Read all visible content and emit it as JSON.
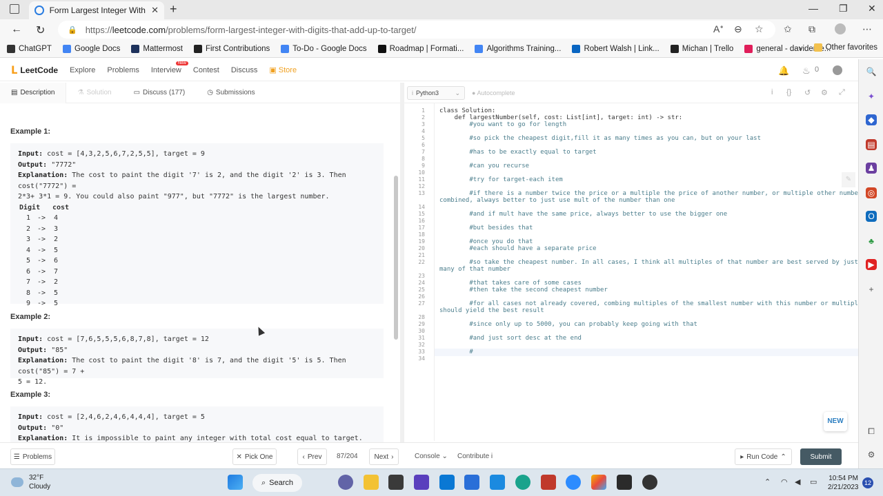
{
  "browser": {
    "tab_title": "Form Largest Integer With Digits",
    "url_prefix": "https://",
    "url_host": "leetcode.com",
    "url_path": "/problems/form-largest-integer-with-digits-that-add-up-to-target/"
  },
  "bookmarks": [
    {
      "label": "ChatGPT",
      "color": "#333333"
    },
    {
      "label": "Google Docs",
      "color": "#4285f4"
    },
    {
      "label": "Mattermost",
      "color": "#1e325c"
    },
    {
      "label": "First Contributions",
      "color": "#222222"
    },
    {
      "label": "To-Do - Google Docs",
      "color": "#4285f4"
    },
    {
      "label": "Roadmap | Formati...",
      "color": "#111111"
    },
    {
      "label": "Algorithms Training...",
      "color": "#4285f4"
    },
    {
      "label": "Robert Walsh | Link...",
      "color": "#0a66c2"
    },
    {
      "label": "Michan | Trello",
      "color": "#222222"
    },
    {
      "label": "general - davideme...",
      "color": "#e01e5a"
    }
  ],
  "bookmarks_other": "Other favorites",
  "lcnav": {
    "logo": "LeetCode",
    "items": [
      "Explore",
      "Problems",
      "Interview",
      "Contest",
      "Discuss"
    ],
    "store": "Store",
    "new_badge": "New",
    "flame_count": "0"
  },
  "lefttabs": {
    "description": "Description",
    "solution": "Solution",
    "discuss": "Discuss (177)",
    "submissions": "Submissions"
  },
  "examples": [
    {
      "heading": "Example 1:",
      "input_label": "Input:",
      "input": "cost = [4,3,2,5,6,7,2,5,5], target = 9",
      "output_label": "Output:",
      "output": "\"7772\"",
      "expl_label": "Explanation:",
      "explanation1": "The cost to paint the digit '7' is 2, and the digit '2' is 3. Then cost(\"7772\") =",
      "explanation2": "2*3+ 3*1 = 9. You could also paint \"977\", but \"7772\" is the largest number.",
      "table_headers": [
        "Digit",
        "cost"
      ],
      "table_rows": [
        [
          "1",
          "->",
          "4"
        ],
        [
          "2",
          "->",
          "3"
        ],
        [
          "3",
          "->",
          "2"
        ],
        [
          "4",
          "->",
          "5"
        ],
        [
          "5",
          "->",
          "6"
        ],
        [
          "6",
          "->",
          "7"
        ],
        [
          "7",
          "->",
          "2"
        ],
        [
          "8",
          "->",
          "5"
        ],
        [
          "9",
          "->",
          "5"
        ]
      ]
    },
    {
      "heading": "Example 2:",
      "input_label": "Input:",
      "input": "cost = [7,6,5,5,5,6,8,7,8], target = 12",
      "output_label": "Output:",
      "output": "\"85\"",
      "expl_label": "Explanation:",
      "explanation1": "The cost to paint the digit '8' is 7, and the digit '5' is 5. Then cost(\"85\") = 7 +",
      "explanation2": "5 = 12."
    },
    {
      "heading": "Example 3:",
      "input_label": "Input:",
      "input": "cost = [2,4,6,2,4,6,4,4,4], target = 5",
      "output_label": "Output:",
      "output": "\"0\"",
      "expl_label": "Explanation:",
      "explanation1": "It is impossible to paint any integer with total cost equal to target."
    }
  ],
  "editor": {
    "language": "Python3",
    "autocomplete": "Autocomplete"
  },
  "code_lines": [
    {
      "n": "1",
      "t": "class Solution:",
      "c": false
    },
    {
      "n": "2",
      "t": "    def largestNumber(self, cost: List[int], target: int) -> str:",
      "c": false
    },
    {
      "n": "3",
      "t": "        #you want to go for length",
      "c": true
    },
    {
      "n": "4",
      "t": "",
      "c": false
    },
    {
      "n": "5",
      "t": "        #so pick the cheapest digit,fill it as many times as you can, but on your last",
      "c": true
    },
    {
      "n": "6",
      "t": "",
      "c": false
    },
    {
      "n": "7",
      "t": "        #has to be exactly equal to target",
      "c": true
    },
    {
      "n": "8",
      "t": "",
      "c": false
    },
    {
      "n": "9",
      "t": "        #can you recurse",
      "c": true
    },
    {
      "n": "10",
      "t": "",
      "c": false
    },
    {
      "n": "11",
      "t": "        #try for target-each item",
      "c": true
    },
    {
      "n": "12",
      "t": "",
      "c": false
    },
    {
      "n": "13",
      "t": "        #if there is a number twice the price or a multiple the price of another number, or multiple other numbers",
      "c": true
    },
    {
      "n": "",
      "t": "combined, always better to just use mult of the number than one",
      "c": true
    },
    {
      "n": "14",
      "t": "",
      "c": false
    },
    {
      "n": "15",
      "t": "        #and if mult have the same price, always better to use the bigger one",
      "c": true
    },
    {
      "n": "16",
      "t": "",
      "c": false
    },
    {
      "n": "17",
      "t": "        #but besides that",
      "c": true
    },
    {
      "n": "18",
      "t": "",
      "c": false
    },
    {
      "n": "19",
      "t": "        #once you do that",
      "c": true
    },
    {
      "n": "20",
      "t": "        #each should have a separate price",
      "c": true
    },
    {
      "n": "21",
      "t": "",
      "c": false
    },
    {
      "n": "22",
      "t": "        #so take the cheapest number. In all cases, I think all multiples of that number are best served by just using",
      "c": true
    },
    {
      "n": "",
      "t": "many of that number",
      "c": true
    },
    {
      "n": "23",
      "t": "",
      "c": false
    },
    {
      "n": "24",
      "t": "        #that takes care of some cases",
      "c": true
    },
    {
      "n": "25",
      "t": "        #then take the second cheapest number",
      "c": true
    },
    {
      "n": "26",
      "t": "",
      "c": false
    },
    {
      "n": "27",
      "t": "        #for all cases not already covered, combing multiples of the smallest number with this number or multiples of it",
      "c": true
    },
    {
      "n": "",
      "t": "should yield the best result",
      "c": true
    },
    {
      "n": "28",
      "t": "",
      "c": false
    },
    {
      "n": "29",
      "t": "        #since only up to 5000, you can probably keep going with that",
      "c": true
    },
    {
      "n": "30",
      "t": "",
      "c": false
    },
    {
      "n": "31",
      "t": "        #and just sort desc at the end",
      "c": true
    },
    {
      "n": "32",
      "t": "",
      "c": false
    },
    {
      "n": "33",
      "t": "        #",
      "c": true
    },
    {
      "n": "34",
      "t": "",
      "c": false
    }
  ],
  "new_button": "NEW",
  "bottom": {
    "problems": "Problems",
    "pick_one": "Pick One",
    "prev": "Prev",
    "page": "87/204",
    "next": "Next",
    "console": "Console",
    "contribute": "Contribute",
    "run_code": "Run Code",
    "submit": "Submit"
  },
  "taskbar": {
    "temp": "32°F",
    "weather": "Cloudy",
    "search": "Search",
    "time": "10:54 PM",
    "date": "2/21/2023",
    "notifications": "12"
  }
}
